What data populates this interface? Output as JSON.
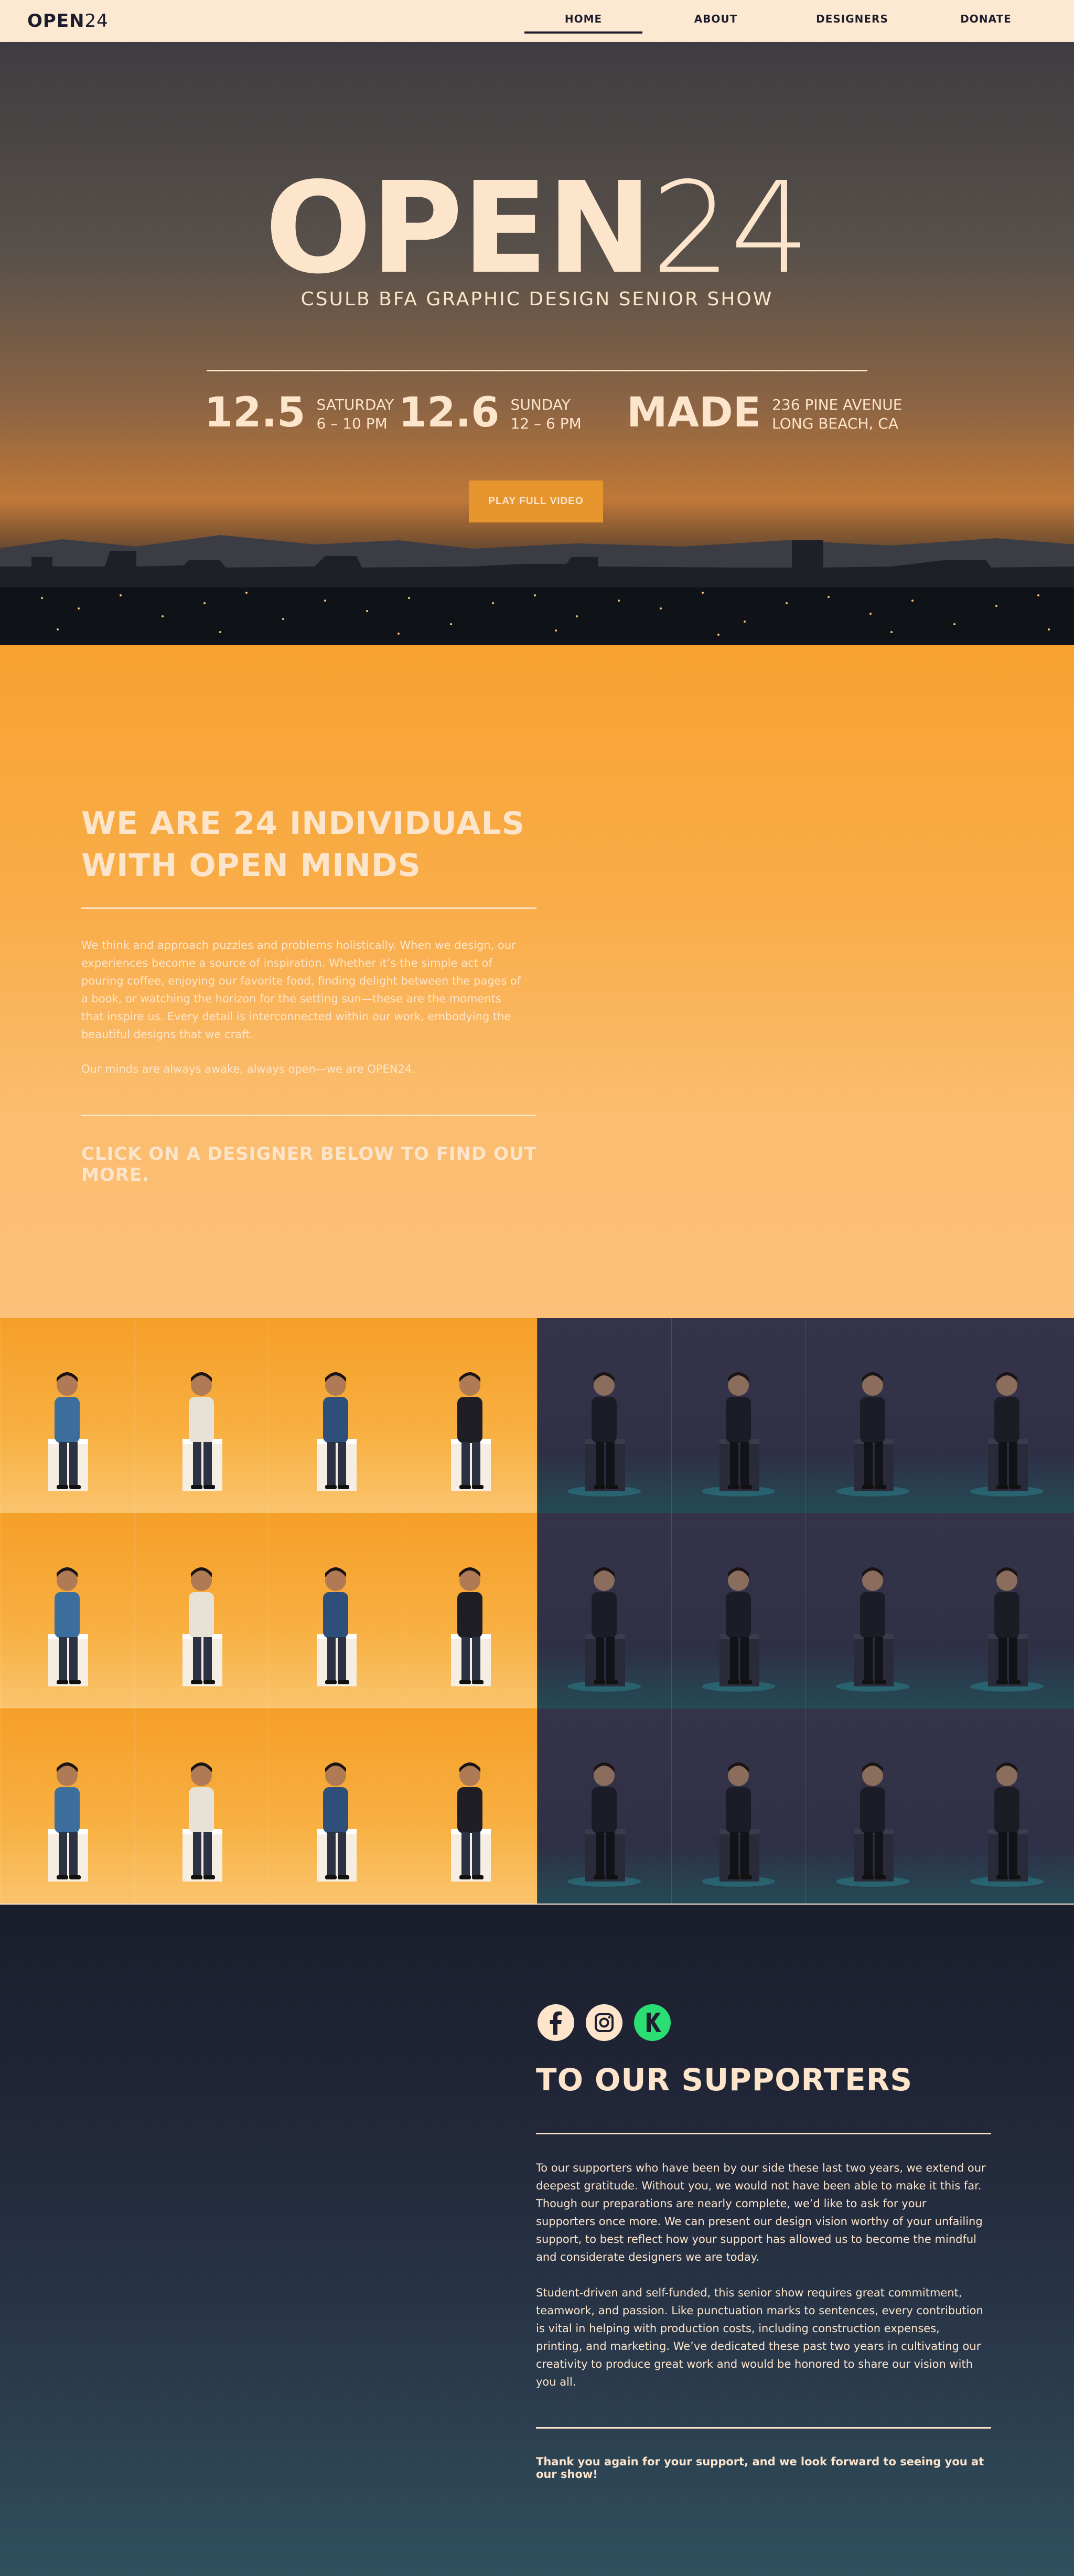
{
  "nav": {
    "logo_bold": "OPEN",
    "logo_num": "24",
    "items": [
      {
        "label": "HOME"
      },
      {
        "label": "ABOUT"
      },
      {
        "label": "DESIGNERS"
      },
      {
        "label": "DONATE"
      }
    ],
    "active": "HOME"
  },
  "hero": {
    "title_bold": "OPEN",
    "title_num": "24",
    "subtitle": "CSULB BFA GRAPHIC DESIGN SENIOR SHOW",
    "events": [
      {
        "big": "12.5",
        "line1": "SATURDAY",
        "line2": "6 – 10 PM"
      },
      {
        "big": "12.6",
        "line1": "SUNDAY",
        "line2": "12 – 6 PM"
      },
      {
        "big": "MADE",
        "line1": "236 PINE AVENUE",
        "line2": "LONG BEACH, CA"
      }
    ],
    "play_button": "PLAY FULL VIDEO"
  },
  "about": {
    "title": "WE ARE 24 INDIVIDUALS WITH OPEN MINDS",
    "paragraph1": "We think and approach puzzles and problems holistically. When we design, our experiences become a source of inspiration. Whether it’s the simple act of pouring coffee, enjoying our favorite food, finding delight between the pages of a book, or watching the horizon for the setting sun—these are the moments that inspire us. Every detail is interconnected within our work, embodying the beautiful designs that we craft.",
    "paragraph2": "Our minds are always awake, always open—we are OPEN24.",
    "cta": "CLICK ON A DESIGNER BELOW TO FIND OUT MORE."
  },
  "designers": {
    "warm_color": "#f8a836",
    "cool_color": "#302f45",
    "count": 24
  },
  "social": [
    {
      "icon": "facebook-icon",
      "color": "#fde5cb"
    },
    {
      "icon": "instagram-icon",
      "color": "#fde5cb"
    },
    {
      "icon": "kickstarter-icon",
      "color": "#2bde73"
    }
  ],
  "supporters": {
    "title": "TO OUR SUPPORTERS",
    "paragraph1": "To our supporters who have been by our side these last two years, we extend our deepest gratitude. Without you, we would not have been able to make it this far. Though our preparations are nearly complete, we’d like to ask for your supporters once more. We can present our design vision worthy of your unfailing support, to best reflect how your support has allowed us to become the mindful and considerate designers we are today.",
    "paragraph2": "Student-driven and self-funded, this senior show requires great commitment, teamwork, and passion. Like punctuation marks to sentences, every contribution is vital in helping with production costs, including construction expenses, printing, and marketing. We’ve dedicated these past two years in cultivating our creativity to produce great work and would be honored to share our vision with you all.",
    "thanks": "Thank you again for your support, and we look forward to seeing you at our show!"
  }
}
